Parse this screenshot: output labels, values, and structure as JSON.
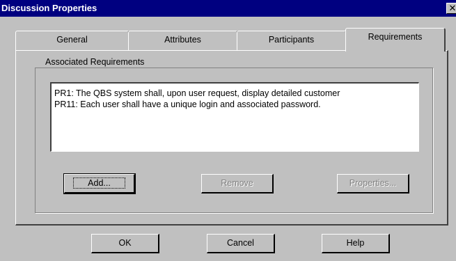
{
  "window": {
    "title": "Discussion Properties",
    "close_glyph": "✕"
  },
  "tabs": [
    {
      "label": "General",
      "active": false
    },
    {
      "label": "Attributes",
      "active": false
    },
    {
      "label": "Participants",
      "active": false
    },
    {
      "label": "Requirements",
      "active": true
    }
  ],
  "associated_requirements": {
    "group_label": "Associated Requirements",
    "items": [
      "PR1: The QBS system shall, upon user request, display detailed customer",
      "PR11: Each user shall have a unique login and associated password."
    ],
    "buttons": {
      "add": "Add...",
      "remove": "Remove",
      "properties": "Properties..."
    }
  },
  "dialog_buttons": {
    "ok": "OK",
    "cancel": "Cancel",
    "help": "Help"
  }
}
